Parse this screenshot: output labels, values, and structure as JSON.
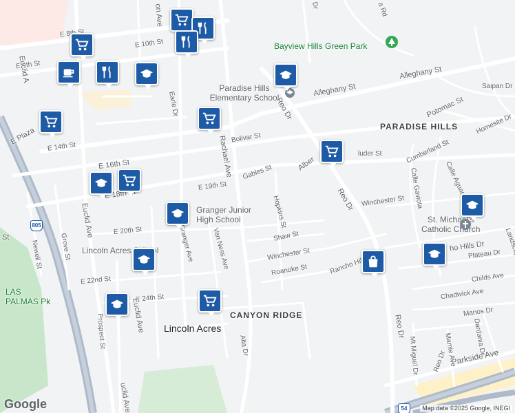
{
  "map": {
    "neighborhoods": {
      "paradise_hills": "PARADISE HILLS",
      "canyon_ridge": "CANYON RIDGE"
    },
    "cities": {
      "lincoln_acres": "Lincoln Acres"
    },
    "pois": {
      "bayview_park": "Bayview Hills Green Park",
      "paradise_school": "Paradise Hills\nElementary School",
      "granger_school": "Granger Junior\nHigh School",
      "lincoln_school": "Lincoln Acres School",
      "st_michaels": "St. Michael's\nCatholic Church",
      "las_palmas": "LAS\nPALMAS Pk"
    },
    "streets": {
      "e_8th": "E 8th St",
      "e_9th": "E 9th St",
      "e_10th": "E 10th St",
      "e_14th": "E 14th St",
      "e_16th": "E 16th St",
      "e_18th": "E 18th St",
      "e_19th": "E 19th St",
      "e_20th": "E 20th St",
      "e_22nd": "E 22nd St",
      "e_24th": "E 24th St",
      "e_plaza": "E Plaza",
      "euclid_ave_1": "Euclid Ave",
      "euclid_ave_2": "Euclid Ave",
      "euclid_ave_3": "Euclid Ave",
      "euclid_ave_4": "uclid Ave",
      "euclid_av_top": "Euclid A",
      "rachael_ave": "Rachael Ave",
      "van_ness_ave": "Van Ness Ave",
      "granger_ave": "Granger Ave",
      "earle_dr": "Earle Dr",
      "alta_dr": "Alta Dr",
      "hopkins_st": "Hopkins St",
      "reo_dr_1": "Reo Dr",
      "reo_dr_2": "Reo Dr",
      "reo_dr_3": "Reo Dr",
      "reo_dr_4": "Reo Dr",
      "bolivar_st": "Bolivar St",
      "gables_st": "Gables St",
      "shaw_st": "Shaw St",
      "winchester_st_1": "Winchester St",
      "winchester_st_2": "Winchester St",
      "roanoke_st": "Roanoke St",
      "alleghany_st_1": "Alleghany St",
      "alleghany_st_2": "Alleghany St",
      "potomac_st": "Potomac St",
      "homesite_dr": "Homesite Dr",
      "saipan_dr": "Saipan Dr",
      "cumberland_st": "Cumberland St",
      "calle_aguadulce": "Calle Aguadulce",
      "calle_gaviota": "Calle Gaviota",
      "rancho_hills_dr_1": "Rancho Hills Dr",
      "rancho_hills_dr_2": "ho Hills Dr",
      "plateau_dr": "Plateau Dr",
      "childs_ave": "Childs Ave",
      "chadwick_ave": "Chadwick Ave",
      "manos_dr": "Manos Dr",
      "dardania_dr": "Dardania Dr",
      "mamie_ave": "Mamie Ave",
      "mt_miguel_dr": "Mt Miguel Dr",
      "parkside_ave": "Parkside Ave",
      "grove_st": "Grove St",
      "newell_st": "Newell St",
      "prospect_st": "Prospect St",
      "landscape": "Landscape",
      "alber": "Alber",
      "sluder_st": "luder St",
      "on_ave": "on Ave",
      "st_left": "St",
      "a_rd": "a Rd",
      "dr_top": "Dr",
      "e_18th_prefix": "E",
      "fw_805": "805",
      "fw_54": "54"
    },
    "attribution": "Map data ©2025 Google, INEGI",
    "logo": "Google",
    "colors": {
      "road": "#ffffff",
      "freeway": "#9aa7b8",
      "park": "#c8e6c9",
      "pin": "#1e5ba6",
      "label": "#5f6368",
      "park_label": "#188038"
    }
  }
}
